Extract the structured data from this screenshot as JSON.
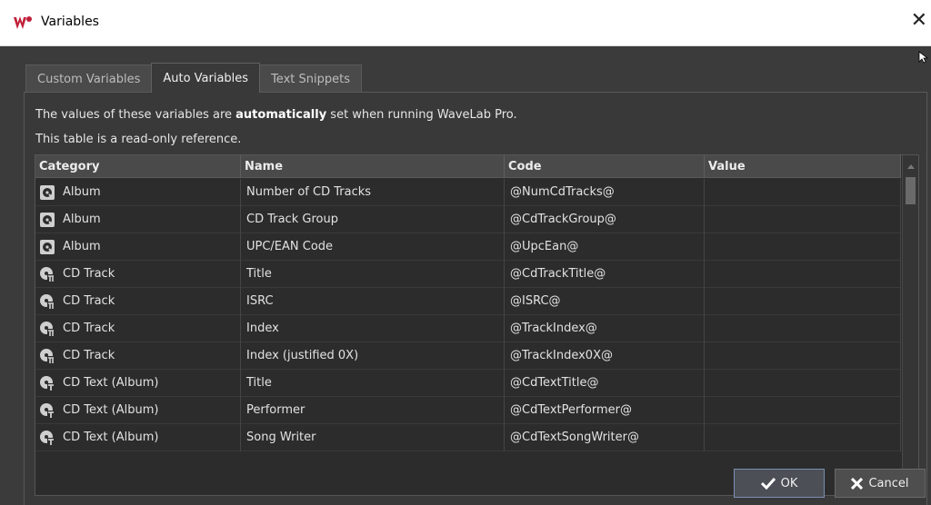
{
  "window": {
    "title": "Variables",
    "close_glyph": "✕"
  },
  "tabs": [
    {
      "label": "Custom Variables",
      "active": false
    },
    {
      "label": "Auto Variables",
      "active": true
    },
    {
      "label": "Text Snippets",
      "active": false
    }
  ],
  "info": {
    "line1_before": "The values of these variables are ",
    "line1_bold": "automatically",
    "line1_after": " set when running WaveLab Pro.",
    "line2": "This table is a read-only reference."
  },
  "table": {
    "headers": [
      "Category",
      "Name",
      "Code",
      "Value"
    ],
    "rows": [
      {
        "icon": "album-icon",
        "category": "Album",
        "name": "Number of CD Tracks",
        "code": "@NumCdTracks@",
        "value": ""
      },
      {
        "icon": "album-icon",
        "category": "Album",
        "name": "CD Track Group",
        "code": "@CdTrackGroup@",
        "value": ""
      },
      {
        "icon": "album-icon",
        "category": "Album",
        "name": "UPC/EAN Code",
        "code": "@UpcEan@",
        "value": ""
      },
      {
        "icon": "cd-track-icon",
        "category": "CD Track",
        "name": "Title",
        "code": "@CdTrackTitle@",
        "value": ""
      },
      {
        "icon": "cd-track-icon",
        "category": "CD Track",
        "name": "ISRC",
        "code": "@ISRC@",
        "value": ""
      },
      {
        "icon": "cd-track-icon",
        "category": "CD Track",
        "name": "Index",
        "code": "@TrackIndex@",
        "value": ""
      },
      {
        "icon": "cd-track-icon",
        "category": "CD Track",
        "name": "Index (justified 0X)",
        "code": "@TrackIndex0X@",
        "value": ""
      },
      {
        "icon": "cd-text-icon",
        "category": "CD Text (Album)",
        "name": "Title",
        "code": "@CdTextTitle@",
        "value": ""
      },
      {
        "icon": "cd-text-icon",
        "category": "CD Text (Album)",
        "name": "Performer",
        "code": "@CdTextPerformer@",
        "value": ""
      },
      {
        "icon": "cd-text-icon",
        "category": "CD Text (Album)",
        "name": "Song Writer",
        "code": "@CdTextSongWriter@",
        "value": ""
      }
    ]
  },
  "buttons": {
    "ok_label": "OK",
    "cancel_label": "Cancel"
  },
  "colors": {
    "accent": "#c0203a",
    "background": "#3b3b3b",
    "table_bg": "#2c2c2c"
  }
}
